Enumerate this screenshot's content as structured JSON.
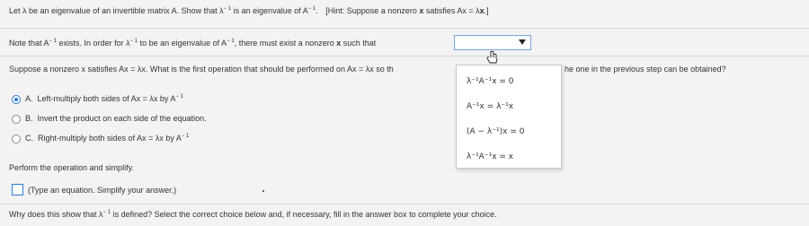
{
  "question": {
    "prompt_a": "Let λ be an eigenvalue of an invertible matrix A. Show that λ",
    "prompt_b": " is an eigenvalue of A",
    "prompt_c": ".",
    "hint_a": "[Hint: Suppose a nonzero ",
    "hint_x": "x",
    "hint_b": " satisfies Ax = λ",
    "hint_x2": "x",
    "hint_c": ".]",
    "sup": "− 1"
  },
  "step1": {
    "text_a": "Note that A",
    "text_b": " exists. In order for λ",
    "text_c": " to be an eigenvalue of A",
    "text_d": ", there must exist a nonzero ",
    "text_x": "x",
    "text_e": " such that",
    "dropdown_value": ""
  },
  "step2": {
    "text_left": "Suppose a nonzero x satisfies Ax = λx. What is the first operation that should be performed on Ax = λx so th",
    "text_right": "he one in the previous step can be obtained?"
  },
  "dropdown_menu": {
    "options": [
      "λ⁻¹A⁻¹x = 0",
      "A⁻¹x = λ⁻¹x",
      "(A − λ⁻¹)x = 0",
      "λ⁻¹A⁻¹x = x"
    ]
  },
  "choices": [
    {
      "letter": "A.",
      "text": "Left-multiply both sides of Ax = λx by A",
      "sup": "− 1",
      "selected": true
    },
    {
      "letter": "B.",
      "text": "Invert the product on each side of the equation.",
      "sup": "",
      "selected": false
    },
    {
      "letter": "C.",
      "text": "Right-multiply both sides of Ax = λx by A",
      "sup": "− 1",
      "selected": false
    }
  ],
  "step3": {
    "instruction": "Perform the operation and simplify.",
    "answer_hint": "(Type an equation. Simplify your answer.)"
  },
  "step4": {
    "text_a": "Why does this show that λ",
    "text_b": " is defined? Select the correct choice below and, if necessary, fill in the answer box to complete your choice."
  },
  "colors": {
    "accent": "#2b7bd6",
    "background": "#f3f3f3",
    "text": "#333333"
  }
}
